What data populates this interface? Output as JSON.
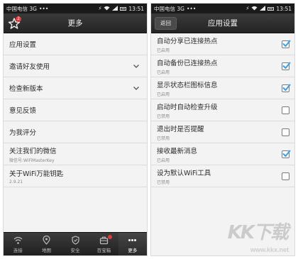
{
  "left_screen": {
    "statusbar": {
      "carrier": "中国电信 3G",
      "dots": "•••",
      "time": "13:51"
    },
    "title": "更多",
    "badge_count": "2",
    "menu": [
      {
        "label": "应用设置"
      },
      {
        "label": "邀请好友使用",
        "has_chevron": true
      },
      {
        "label": "检查新版本",
        "has_chevron": true
      },
      {
        "label": "意见反馈"
      },
      {
        "label": "为我评分"
      },
      {
        "label": "关注我们的微信",
        "sub": "微信号:WiFiMasterKey"
      },
      {
        "label": "关于WiFi万能钥匙",
        "sub": "2.9.21"
      }
    ],
    "tabs": [
      {
        "label": "连接",
        "icon": "wifi-icon"
      },
      {
        "label": "地图",
        "icon": "map-pin-icon"
      },
      {
        "label": "安全",
        "icon": "shield-icon"
      },
      {
        "label": "百宝箱",
        "icon": "toolbox-icon"
      },
      {
        "label": "更多",
        "icon": "more-dots-icon"
      }
    ]
  },
  "right_screen": {
    "statusbar": {
      "carrier": "中国电信 3G",
      "dots": "•••",
      "time": "13:51"
    },
    "back_label": "返回",
    "title": "应用设置",
    "settings": [
      {
        "label": "自动分享已连接热点",
        "status": "已启用",
        "checked": true
      },
      {
        "label": "自动备份已连接热点",
        "status": "已启用",
        "checked": true
      },
      {
        "label": "显示状态栏图标信息",
        "status": "已启用",
        "checked": true
      },
      {
        "label": "启动时自动检查升级",
        "status": "已禁用",
        "checked": false
      },
      {
        "label": "退出时是否提醒",
        "status": "已禁用",
        "checked": false
      },
      {
        "label": "接收最新消息",
        "status": "已启用",
        "checked": true
      },
      {
        "label": "设为默认WiFi工具",
        "status": "已禁用",
        "checked": false
      }
    ]
  },
  "watermark": {
    "logo": "KK下载",
    "url": "www.kkx.net"
  },
  "colors": {
    "accent_check": "#3aa0e6",
    "badge": "#e23b3b",
    "bar_dark": "#242424"
  }
}
